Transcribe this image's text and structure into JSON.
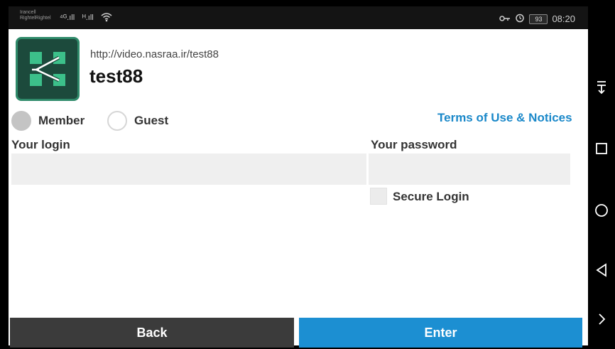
{
  "status_bar": {
    "carrier_line1": "Irancell",
    "carrier_line2": "RightelRightel",
    "signal1": "⁴ᴳ.ıll",
    "signal2": "ᴴ.ıll",
    "wifi_icon": "wifi-icon",
    "key_icon": "key-icon",
    "alarm_icon": "alarm-icon",
    "battery": "93",
    "time": "08:20"
  },
  "header": {
    "url": "http://video.nasraa.ir/test88",
    "title": "test88",
    "logo_icon": "adobe-connect-logo",
    "logo_color": "#1c4a3c",
    "logo_accent": "#3cc08a"
  },
  "roles": {
    "member_label": "Member",
    "guest_label": "Guest",
    "selected": "Member"
  },
  "terms_link": "Terms of Use & Notices",
  "form": {
    "login_label": "Your login",
    "login_value": "",
    "password_label": "Your password",
    "password_value": "",
    "secure_label": "Secure Login",
    "secure_checked": false
  },
  "buttons": {
    "back_label": "Back",
    "enter_label": "Enter"
  },
  "nav": {
    "items": [
      "expand-notifications-icon",
      "recents-square-icon",
      "home-circle-icon",
      "back-triangle-icon",
      "chevron-right-icon"
    ]
  },
  "colors": {
    "accent": "#1c8fd2",
    "link": "#1a88c9",
    "back_button": "#3b3b3b"
  }
}
